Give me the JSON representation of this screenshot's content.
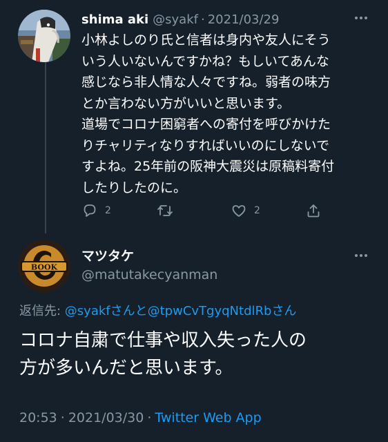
{
  "tweet1": {
    "name": "shima aki",
    "handle": "@syakf",
    "separator": "·",
    "date": "2021/03/29",
    "text_lines": [
      "小林よしのり氏と信者は身内や友人にそう",
      "いう人いないんですかね？もしいてあんな",
      "感じなら非人情な人々ですね。弱者の味方",
      "とか言わない方がいいと思います。",
      "道場でコロナ困窮者への寄付を呼びかけた",
      "りチャリティなりすればいいのにしないで",
      "すよね。25年前の阪神大震災は原稿料寄付",
      "したりしたのに。"
    ],
    "reply_count": "2",
    "like_count": "2",
    "icons": [
      "more-icon",
      "reply-icon",
      "retweet-icon",
      "like-icon",
      "share-icon"
    ]
  },
  "tweet2": {
    "name": "マツタケ",
    "handle": "@matutakecyanman",
    "reply_prefix": "返信先: ",
    "reply_user1": "@syakf",
    "reply_joiner": "さんと",
    "reply_user2": "@tpwCvTgyqNtdlRb",
    "reply_suffix": "さん",
    "text_lines": [
      "コロナ自粛で仕事や収入失った人の",
      "方が多いんだと思います。"
    ],
    "time": "20:53",
    "separator": "·",
    "date": "2021/03/30",
    "source": "Twitter Web App",
    "avatar_logo_text": "BOOK"
  },
  "colors": {
    "background": "#15202b",
    "text": "#ffffff",
    "secondary": "#8899a6",
    "link": "#1d9bf0",
    "thread_line": "#38444d"
  }
}
